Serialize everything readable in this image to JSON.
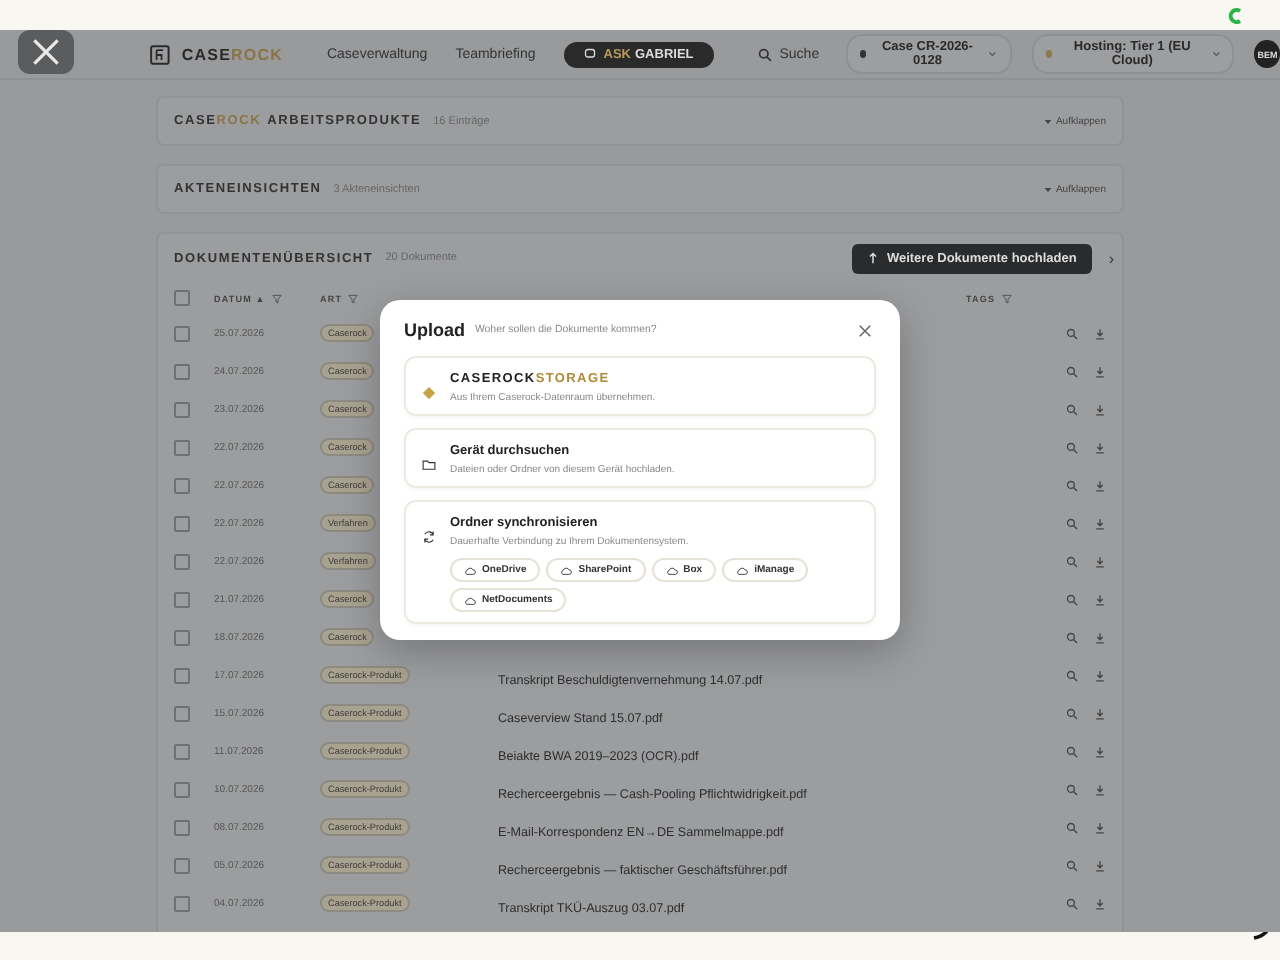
{
  "nav": {
    "logo": [
      {
        "text": "CASE",
        "accent": false
      },
      {
        "text": "ROCK",
        "accent": true
      }
    ],
    "links": [
      {
        "label": "Caseverwaltung"
      },
      {
        "label": "Teambriefing"
      }
    ],
    "ask": [
      {
        "text": "ASK",
        "accent": true
      },
      {
        "text": "GABRIEL",
        "accent": false
      }
    ],
    "search": "Suche",
    "case_pill": "Case CR-2026-0128",
    "hosting_pill": "Hosting: Tier 1 (EU Cloud)",
    "avatar": "BEM"
  },
  "sections": [
    {
      "title": [
        {
          "text": "CASE",
          "accent": false
        },
        {
          "text": "ROCK",
          "accent": true
        },
        {
          "text": "ARBEITSPRODUKTE",
          "accent": false
        }
      ],
      "count": "16 Einträge",
      "toggle": "Aufklappen"
    },
    {
      "title": [
        {
          "text": "AKTENEINSICHTEN",
          "accent": false
        }
      ],
      "count": "3 Akteneinsichten",
      "toggle": "Aufklappen"
    }
  ],
  "documents": {
    "title": "DOKUMENTENÜBERSICHT",
    "count": "20 Dokumente",
    "upload_button": "Weitere Dokumente hochladen",
    "next": "›",
    "select_all": {
      "checked": false
    },
    "columns": [
      {
        "label": "DATUM",
        "sort": "▲"
      },
      {
        "label": "ART"
      },
      {
        "label": "TAGS"
      }
    ],
    "rows": [
      {
        "checked": false,
        "date": "25.07.2026",
        "tag": "Caserock"
      },
      {
        "checked": false,
        "date": "24.07.2026",
        "tag": "Caserock"
      },
      {
        "checked": false,
        "date": "23.07.2026",
        "tag": "Caserock"
      },
      {
        "checked": false,
        "date": "22.07.2026",
        "tag": "Caserock"
      },
      {
        "checked": false,
        "date": "22.07.2026",
        "tag": "Caserock"
      },
      {
        "checked": false,
        "date": "22.07.2026",
        "tag": "Verfahren"
      },
      {
        "checked": false,
        "date": "22.07.2026",
        "tag": "Verfahren"
      },
      {
        "checked": false,
        "date": "21.07.2026",
        "tag": "Caserock"
      },
      {
        "checked": false,
        "date": "18.07.2026",
        "tag": "Caserock"
      },
      {
        "checked": false,
        "date": "17.07.2026",
        "tag": "Caserock-Produkt",
        "name": "Transkript Beschuldigtenvernehmung 14.07.pdf"
      },
      {
        "checked": false,
        "date": "15.07.2026",
        "tag": "Caserock-Produkt",
        "name": "Caseverview Stand 15.07.pdf"
      },
      {
        "checked": false,
        "date": "11.07.2026",
        "tag": "Caserock-Produkt",
        "name": "Beiakte BWA 2019–2023 (OCR).pdf"
      },
      {
        "checked": false,
        "date": "10.07.2026",
        "tag": "Caserock-Produkt",
        "name": "Recherceergebnis — Cash-Pooling Pflichtwidrigkeit.pdf"
      },
      {
        "checked": false,
        "date": "08.07.2026",
        "tag": "Caserock-Produkt",
        "name": "E-Mail-Korrespondenz EN→DE Sammelmappe.pdf"
      },
      {
        "checked": false,
        "date": "05.07.2026",
        "tag": "Caserock-Produkt",
        "name": "Recherceergebnis — faktischer Geschäftsführer.pdf"
      },
      {
        "checked": false,
        "date": "04.07.2026",
        "tag": "Caserock-Produkt",
        "name": "Transkript TKÜ-Auszug 03.07.pdf"
      }
    ]
  },
  "modal": {
    "title": "Upload",
    "subtitle": "Woher sollen die Dokumente kommen?",
    "options": [
      {
        "kind": "storage",
        "title": [
          {
            "text": "CASEROCK",
            "accent": false
          },
          {
            "text": "STORAGE",
            "accent": true
          }
        ],
        "description": "Aus Ihrem Caserock-Datenraum übernehmen."
      },
      {
        "kind": "device",
        "title": [
          {
            "text": "Gerät durchsuchen",
            "accent": false
          }
        ],
        "description": "Dateien oder Ordner von diesem Gerät hochladen."
      },
      {
        "kind": "sync",
        "title": [
          {
            "text": "Ordner synchronisieren",
            "accent": false
          }
        ],
        "description": "Dauerhafte Verbindung zu Ihrem Dokumentensystem.",
        "services": [
          "OneDrive",
          "SharePoint",
          "Box",
          "iManage",
          "NetDocuments"
        ]
      }
    ]
  }
}
